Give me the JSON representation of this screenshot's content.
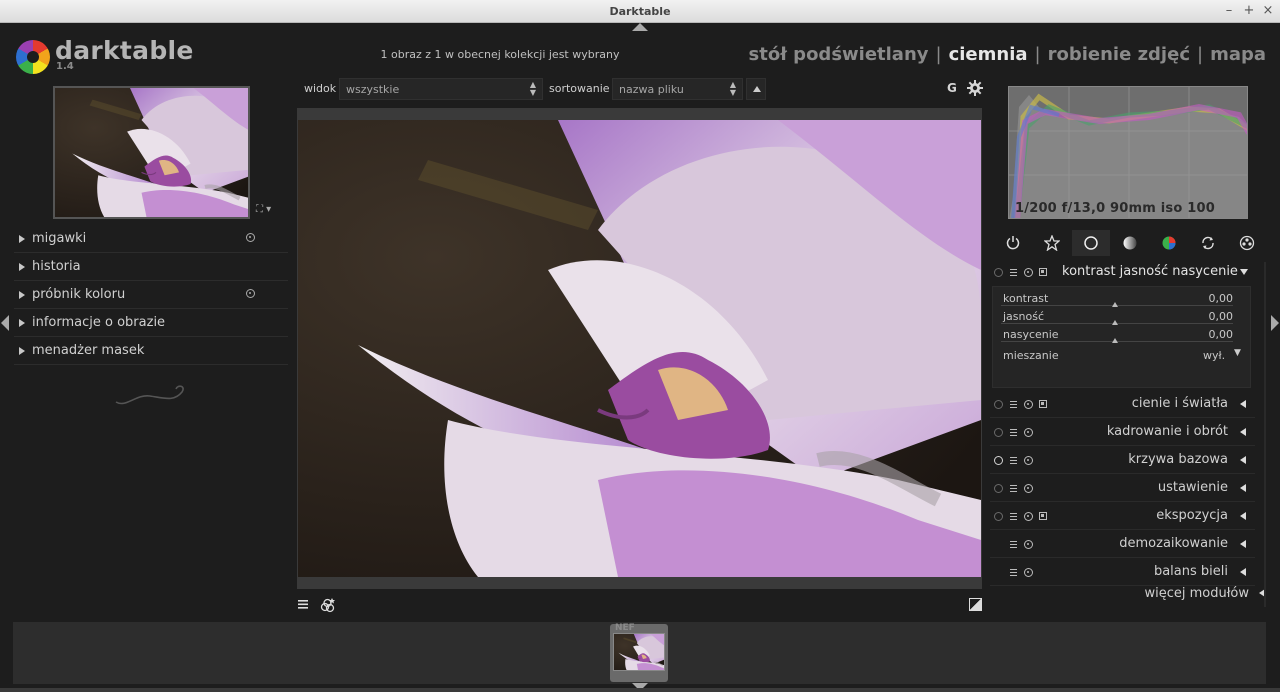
{
  "window": {
    "title": "Darktable"
  },
  "header": {
    "app_name": "darktable",
    "version": "1.4",
    "selection_info": "1 obraz z 1 w obecnej kolekcji jest wybrany",
    "views": [
      {
        "label": "stół podświetlany",
        "active": false
      },
      {
        "label": "ciemnia",
        "active": true
      },
      {
        "label": "robienie zdjęć",
        "active": false
      },
      {
        "label": "mapa",
        "active": false
      }
    ],
    "separator": "|"
  },
  "left_panel": {
    "modules": [
      {
        "label": "migawki",
        "has_preset": true
      },
      {
        "label": "historia",
        "has_preset": false
      },
      {
        "label": "próbnik koloru",
        "has_preset": true
      },
      {
        "label": "informacje o obrazie",
        "has_preset": false
      },
      {
        "label": "menadżer masek",
        "has_preset": false
      }
    ]
  },
  "toolbar": {
    "view_label": "widok",
    "view_value": "wszystkie",
    "sort_label": "sortowanie",
    "sort_value": "nazwa pliku",
    "grouping_label": "G"
  },
  "histogram": {
    "exif": "1/200 f/13,0 90mm iso 100"
  },
  "right_panel": {
    "module_group_icons": [
      "power-icon",
      "star-icon",
      "circle-icon",
      "tone-icon",
      "color-icon",
      "correct-icon",
      "effect-icon"
    ],
    "active_group": 2,
    "expanded_module": {
      "name": "kontrast jasność nasycenie",
      "sliders": [
        {
          "label": "kontrast",
          "value": "0,00"
        },
        {
          "label": "jasność",
          "value": "0,00"
        },
        {
          "label": "nasycenie",
          "value": "0,00"
        }
      ],
      "blend_label": "mieszanie",
      "blend_value": "wył."
    },
    "modules": [
      {
        "name": "cienie i światła",
        "multi": true,
        "enabled": false
      },
      {
        "name": "kadrowanie i obrót",
        "multi": false,
        "enabled": false
      },
      {
        "name": "krzywa bazowa",
        "multi": false,
        "enabled": true
      },
      {
        "name": "ustawienie",
        "multi": false,
        "enabled": false
      },
      {
        "name": "ekspozycja",
        "multi": true,
        "enabled": false
      },
      {
        "name": "demozaikowanie",
        "multi": false,
        "enabled": null
      },
      {
        "name": "balans bieli",
        "multi": false,
        "enabled": null
      }
    ],
    "more_modules": "więcej modułów"
  },
  "filmstrip": {
    "thumb_label": "NEF"
  },
  "colors": {
    "background": "#1d1d1d",
    "petal": "#b58ad0",
    "text": "#c8c8c8"
  }
}
